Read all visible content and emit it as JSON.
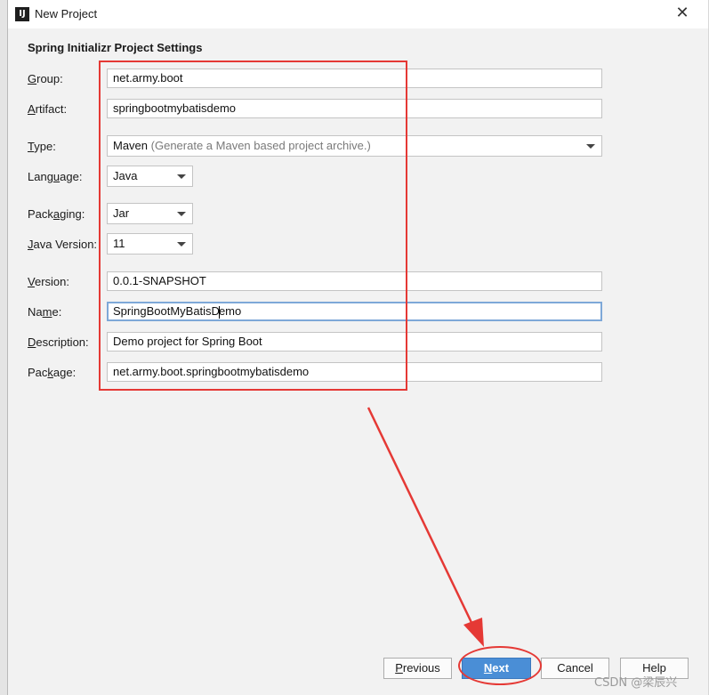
{
  "window": {
    "title": "New Project",
    "app_icon": "intellij-idea-icon",
    "close_glyph": "✕"
  },
  "section_title": "Spring Initializr Project Settings",
  "fields": {
    "group": {
      "label_pre": "",
      "label_key": "G",
      "label_post": "roup:",
      "value": "net.army.boot"
    },
    "artifact": {
      "label_pre": "",
      "label_key": "A",
      "label_post": "rtifact:",
      "value": "springbootmybatisdemo"
    },
    "type": {
      "label_pre": "",
      "label_key": "T",
      "label_post": "ype:",
      "value": "Maven",
      "hint": "(Generate a Maven based project archive.)"
    },
    "language": {
      "label_pre": "Lang",
      "label_key": "u",
      "label_post": "age:",
      "value": "Java"
    },
    "packaging": {
      "label_pre": "Pack",
      "label_key": "a",
      "label_post": "ging:",
      "value": "Jar"
    },
    "java_version": {
      "label_pre": "",
      "label_key": "J",
      "label_post": "ava Version:",
      "value": "11"
    },
    "version": {
      "label_pre": "",
      "label_key": "V",
      "label_post": "ersion:",
      "value": "0.0.1-SNAPSHOT"
    },
    "name": {
      "label_pre": "Na",
      "label_key": "m",
      "label_post": "e:",
      "value_before_caret": "SpringBootMyBatisD",
      "value_after_caret": "emo"
    },
    "description": {
      "label_pre": "",
      "label_key": "D",
      "label_post": "escription:",
      "value": "Demo project for Spring Boot"
    },
    "package": {
      "label_pre": "Pac",
      "label_key": "k",
      "label_post": "age:",
      "value": "net.army.boot.springbootmybatisdemo"
    }
  },
  "buttons": {
    "previous": {
      "pre": "",
      "key": "P",
      "post": "revious"
    },
    "next": {
      "pre": "",
      "key": "N",
      "post": "ext"
    },
    "cancel": "Cancel",
    "help": "Help"
  },
  "annotation_colors": {
    "highlight": "#e53935",
    "primary_button": "#4a8ed6"
  },
  "watermark": "CSDN @梁辰兴"
}
